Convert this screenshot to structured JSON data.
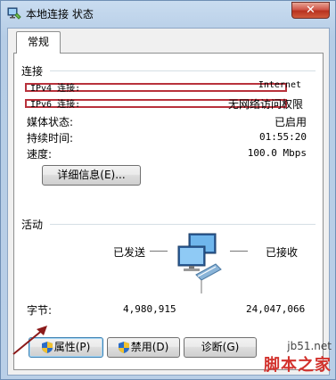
{
  "window": {
    "title": "本地连接 状态",
    "close_glyph": "✕"
  },
  "tab": {
    "label": "常规"
  },
  "connection": {
    "section": "连接",
    "rows": [
      {
        "label": "IPv4 连接:",
        "value": "Internet"
      },
      {
        "label": "IPv6 连接:",
        "value": "无网络访问权限"
      },
      {
        "label": "媒体状态:",
        "value": "已启用"
      },
      {
        "label": "持续时间:",
        "value": "01:55:20"
      },
      {
        "label": "速度:",
        "value": "100.0 Mbps"
      }
    ],
    "details_button": "详细信息(E)..."
  },
  "activity": {
    "section": "活动",
    "sent_label": "已发送",
    "received_label": "已接收",
    "bytes_label": "字节:",
    "sent_value": "4,980,915",
    "received_value": "24,047,066"
  },
  "buttons": {
    "properties": "属性(P)",
    "disable": "禁用(D)",
    "diagnose": "诊断(G)"
  },
  "watermark": {
    "site": "jb51.net",
    "brand": "脚本之家"
  },
  "colors": {
    "annotation_red": "#b8323c",
    "arrow": "#8b1a1a"
  }
}
